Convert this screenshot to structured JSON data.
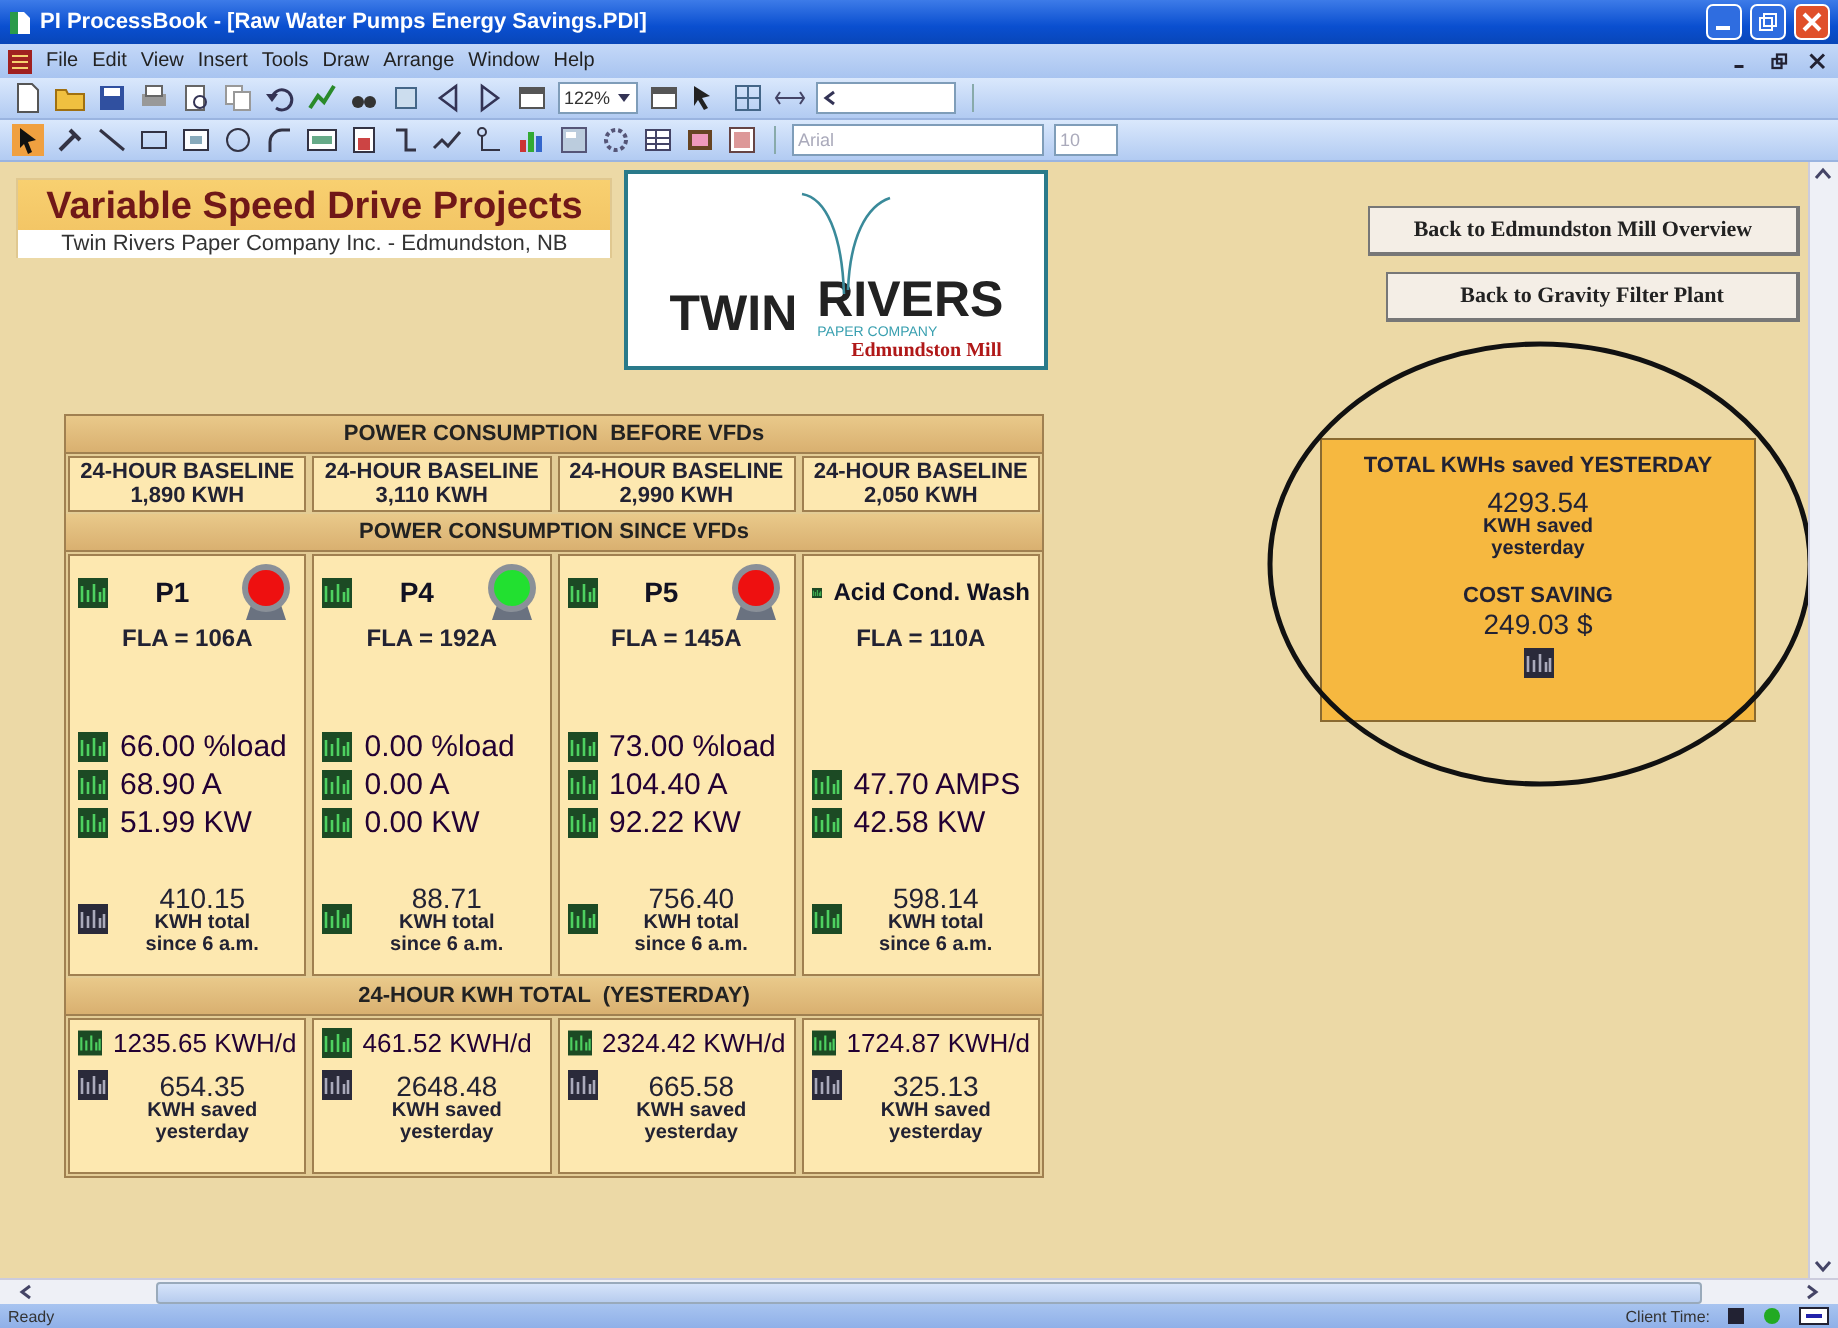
{
  "window": {
    "title": "PI ProcessBook - [Raw Water Pumps Energy Savings.PDI]"
  },
  "menu": [
    "File",
    "Edit",
    "View",
    "Insert",
    "Tools",
    "Draw",
    "Arrange",
    "Window",
    "Help"
  ],
  "toolbar": {
    "zoom": "122%",
    "font": "Arial",
    "font_size": "10"
  },
  "display": {
    "title": "Variable Speed Drive Projects",
    "subtitle": "Twin Rivers Paper Company Inc. - Edmundston, NB",
    "logo": {
      "name_left": "TWIN",
      "name_right": "RIVERS",
      "tagline": "PAPER COMPANY",
      "site": "Edmundston Mill"
    },
    "buttons": [
      "Back to Edmundston Mill Overview",
      "Back to Gravity Filter Plant"
    ],
    "before_heading": "POWER CONSUMPTION  BEFORE VFDs",
    "baselines": [
      {
        "label": "24-HOUR BASELINE",
        "value": "1,890 KWH"
      },
      {
        "label": "24-HOUR BASELINE",
        "value": "3,110 KWH"
      },
      {
        "label": "24-HOUR BASELINE",
        "value": "2,990 KWH"
      },
      {
        "label": "24-HOUR BASELINE",
        "value": "2,050 KWH"
      }
    ],
    "since_heading": "POWER CONSUMPTION SINCE VFDs",
    "pumps": [
      {
        "name": "P1",
        "motor": {
          "running": false
        },
        "fla": "FLA = 106A",
        "readings": [
          "66.00 %load",
          "68.90 A",
          "51.99 KW"
        ],
        "total": "410.15",
        "total_label": "KWH total",
        "total_sub": "since 6 a.m."
      },
      {
        "name": "P4",
        "motor": {
          "running": true
        },
        "fla": "FLA = 192A",
        "readings": [
          "0.00 %load",
          "0.00 A",
          "0.00 KW"
        ],
        "total": "88.71",
        "total_label": "KWH total",
        "total_sub": "since 6 a.m."
      },
      {
        "name": "P5",
        "motor": {
          "running": false
        },
        "fla": "FLA = 145A",
        "readings": [
          "73.00 %load",
          "104.40 A",
          "92.22 KW"
        ],
        "total": "756.40",
        "total_label": "KWH total",
        "total_sub": "since 6 a.m."
      },
      {
        "name": "Acid Cond. Wash",
        "fla": "FLA = 110A",
        "readings": [
          "47.70 AMPS",
          "42.58 KW"
        ],
        "total": "598.14",
        "total_label": "KWH total",
        "total_sub": "since 6 a.m."
      }
    ],
    "yesterday_heading": "24-HOUR KWH TOTAL  (YESTERDAY)",
    "yesterday": [
      {
        "daily": "1235.65 KWH/d",
        "saved": "654.35",
        "saved_label": "KWH saved",
        "saved_sub": "yesterday"
      },
      {
        "daily": "461.52 KWH/d",
        "saved": "2648.48",
        "saved_label": "KWH saved",
        "saved_sub": "yesterday"
      },
      {
        "daily": "2324.42 KWH/d",
        "saved": "665.58",
        "saved_label": "KWH saved",
        "saved_sub": "yesterday"
      },
      {
        "daily": "1724.87 KWH/d",
        "saved": "325.13",
        "saved_label": "KWH saved",
        "saved_sub": "yesterday"
      }
    ],
    "summary": {
      "title": "TOTAL KWHs saved YESTERDAY",
      "saved": "4293.54",
      "saved_label": "KWH saved",
      "saved_sub": "yesterday",
      "cost_label": "COST SAVING",
      "cost": "249.03 $"
    }
  },
  "status_bar": {
    "text": "Ready",
    "client_time": "Client Time:"
  }
}
